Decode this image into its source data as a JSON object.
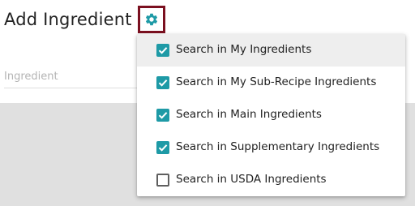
{
  "header": {
    "title": "Add Ingredient",
    "settings_icon": "gear-icon"
  },
  "search": {
    "placeholder": "Ingredient",
    "value": ""
  },
  "colors": {
    "accent": "#1e9aa6",
    "focus_border": "#7b1020"
  },
  "menu": {
    "items": [
      {
        "label": "Search in My Ingredients",
        "checked": true
      },
      {
        "label": "Search in My Sub-Recipe Ingredients",
        "checked": true
      },
      {
        "label": "Search in Main Ingredients",
        "checked": true
      },
      {
        "label": "Search in Supplementary Ingredients",
        "checked": true
      },
      {
        "label": "Search in USDA Ingredients",
        "checked": false
      }
    ]
  }
}
